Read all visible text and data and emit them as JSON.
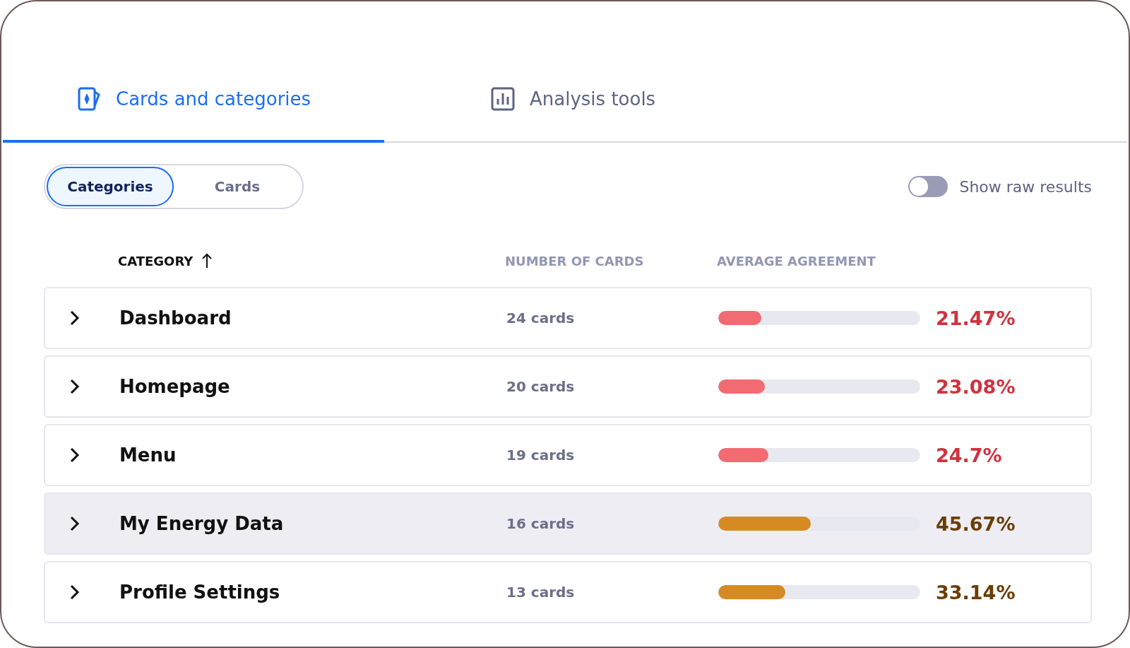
{
  "tabs": [
    {
      "label": "Cards and categories",
      "selected": true
    },
    {
      "label": "Analysis tools",
      "selected": false
    }
  ],
  "view_switch": [
    {
      "label": "Categories",
      "selected": true
    },
    {
      "label": "Cards",
      "selected": false
    }
  ],
  "raw_results_toggle": {
    "label": "Show raw results",
    "on": false
  },
  "table": {
    "columns": [
      {
        "label": "CATEGORY",
        "sorted": true
      },
      {
        "label": "NUMBER OF CARDS",
        "sorted": false
      },
      {
        "label": "AVERAGE AGREEMENT",
        "sorted": false
      }
    ],
    "rows": [
      {
        "category": "Dashboard",
        "cards": "24 cards",
        "level": 0.2147,
        "agreement": "21.47%",
        "kind": "low",
        "highlighted": false
      },
      {
        "category": "Homepage",
        "cards": "20 cards",
        "level": 0.2308,
        "agreement": "23.08%",
        "kind": "low",
        "highlighted": false
      },
      {
        "category": "Menu",
        "cards": "19 cards",
        "level": 0.247,
        "agreement": "24.7%",
        "kind": "low",
        "highlighted": false
      },
      {
        "category": "My Energy Data",
        "cards": "16 cards",
        "level": 0.4567,
        "agreement": "45.67%",
        "kind": "medium",
        "highlighted": true
      },
      {
        "category": "Profile Settings",
        "cards": "13 cards",
        "level": 0.3314,
        "agreement": "33.14%",
        "kind": "medium",
        "highlighted": false
      }
    ]
  }
}
